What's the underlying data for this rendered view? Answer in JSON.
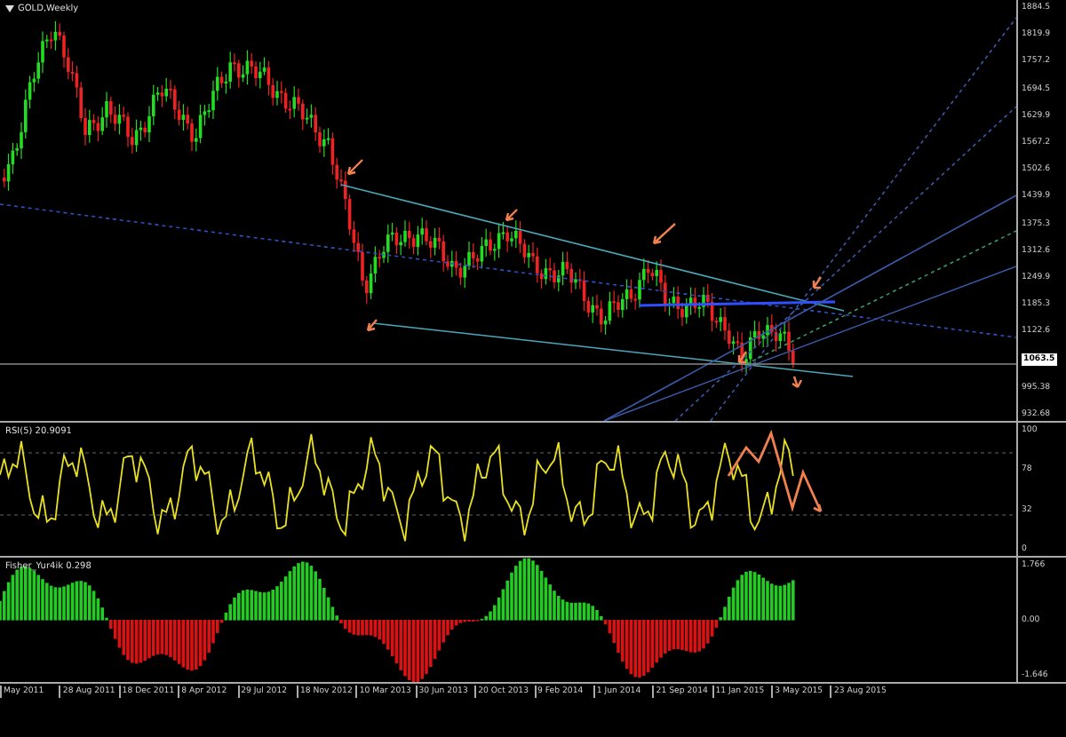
{
  "chart_title": "GOLD,Weekly",
  "price_axis": [
    {
      "text": "1884.5",
      "highlighted": false
    },
    {
      "text": "1819.9",
      "highlighted": false
    },
    {
      "text": "1757.2",
      "highlighted": false
    },
    {
      "text": "1694.5",
      "highlighted": false
    },
    {
      "text": "1629.9",
      "highlighted": false
    },
    {
      "text": "1567.2",
      "highlighted": false
    },
    {
      "text": "1502.6",
      "highlighted": false
    },
    {
      "text": "1439.9",
      "highlighted": false
    },
    {
      "text": "1375.3",
      "highlighted": false
    },
    {
      "text": "1312.6",
      "highlighted": false
    },
    {
      "text": "1249.9",
      "highlighted": false
    },
    {
      "text": "1185.3",
      "highlighted": false
    },
    {
      "text": "1122.6",
      "highlighted": false
    },
    {
      "text": "1063.5",
      "highlighted": true
    },
    {
      "text": "995.38",
      "highlighted": false
    },
    {
      "text": "932.68",
      "highlighted": false
    }
  ],
  "rsi_pane": {
    "title": "RSI(5) 20.9091",
    "levels": [
      "100",
      "78",
      "32",
      "0"
    ]
  },
  "fisher_pane": {
    "title": "Fisher_Yur4ik 0.298",
    "levels": [
      "1.766",
      "0.00",
      "-1.646"
    ]
  },
  "time_axis": [
    "May 2011",
    "28 Aug 2011",
    "18 Dec 2011",
    "8 Apr 2012",
    "29 Jul 2012",
    "18 Nov 2012",
    "10 Mar 2013",
    "30 Jun 2013",
    "20 Oct 2013",
    "9 Feb 2014",
    "1 Jun 2014",
    "21 Sep 2014",
    "11 Jan 2015",
    "3 May 2015",
    "23 Aug 2015"
  ]
}
